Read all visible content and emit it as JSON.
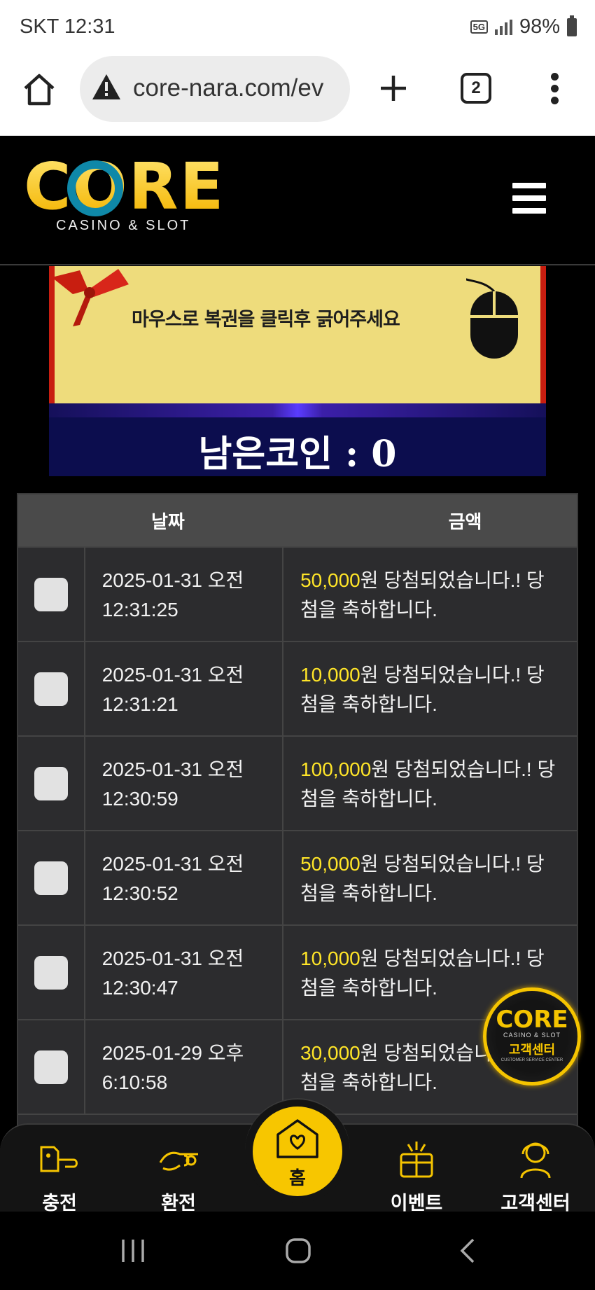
{
  "status_bar": {
    "carrier_time": "SKT 12:31",
    "network": "5G",
    "battery": "98%"
  },
  "browser": {
    "url": "core-nara.com/ev",
    "tab_count": "2"
  },
  "site": {
    "logo_text": "CORE",
    "logo_subtitle": "CASINO & SLOT"
  },
  "banner": {
    "instruction": "마우스로 복권을 클릭후 긁어주세요",
    "remaining_coins": "남은코인 : 0"
  },
  "table": {
    "headers": {
      "date": "날짜",
      "amount": "금액"
    },
    "rows": [
      {
        "date": "2025-01-31 오전",
        "time": "12:31:25",
        "amount": "50,000",
        "msg_a": "원 당첨되었습니다.! 당",
        "msg_b": "첨을 축하합니다."
      },
      {
        "date": "2025-01-31 오전",
        "time": "12:31:21",
        "amount": "10,000",
        "msg_a": "원 당첨되었습니다.! 당",
        "msg_b": "첨을 축하합니다."
      },
      {
        "date": "2025-01-31 오전",
        "time": "12:30:59",
        "amount": "100,000",
        "msg_a": "원 당첨되었습니다.! 당",
        "msg_b": "첨을 축하합니다."
      },
      {
        "date": "2025-01-31 오전",
        "time": "12:30:52",
        "amount": "50,000",
        "msg_a": "원 당첨되었습니다.! 당",
        "msg_b": "첨을 축하합니다."
      },
      {
        "date": "2025-01-31 오전",
        "time": "12:30:47",
        "amount": "10,000",
        "msg_a": "원 당첨되었습니다.! 당",
        "msg_b": "첨을 축하합니다."
      },
      {
        "date": "2025-01-29 오후",
        "time": "6:10:58",
        "amount": "30,000",
        "msg_a": "원 당첨되었습니다.! 당",
        "msg_b": "첨을 축하합니다."
      }
    ]
  },
  "cs_float": {
    "logo": "CORE",
    "sub": "CASINO & SLOT",
    "label": "고객센터",
    "en": "CUSTOMER SERVICE CENTER"
  },
  "bottom_nav": {
    "deposit": "충전",
    "withdraw": "환전",
    "home": "홈",
    "event": "이벤트",
    "support": "고객센터"
  },
  "colors": {
    "accent_yellow": "#f7c600",
    "amount_yellow": "#ffe528",
    "coin_box": "#0c0d4e",
    "banner_red": "#c81e10"
  }
}
